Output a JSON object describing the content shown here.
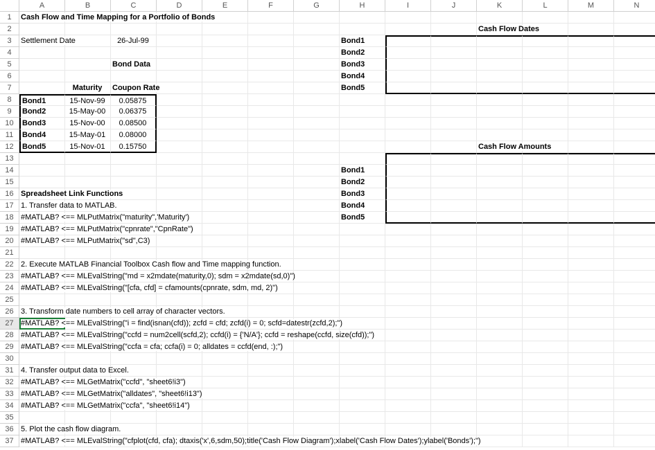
{
  "columns": [
    "A",
    "B",
    "C",
    "D",
    "E",
    "F",
    "G",
    "H",
    "I",
    "J",
    "K",
    "L",
    "M",
    "N"
  ],
  "row_count": 37,
  "selected_row": 27,
  "title": "Cash Flow and Time Mapping for a Portfolio of Bonds",
  "settlement_label": "Settlement Date",
  "settlement_date": "26-Jul-99",
  "bond_data_heading": "Bond Data",
  "maturity_header": "Maturity",
  "coupon_header": "Coupon Rate",
  "bonds": [
    {
      "name": "Bond1",
      "maturity": "15-Nov-99",
      "coupon": "0.05875"
    },
    {
      "name": "Bond2",
      "maturity": "15-May-00",
      "coupon": "0.06375"
    },
    {
      "name": "Bond3",
      "maturity": "15-Nov-00",
      "coupon": "0.08500"
    },
    {
      "name": "Bond4",
      "maturity": "15-May-01",
      "coupon": "0.08000"
    },
    {
      "name": "Bond5",
      "maturity": "15-Nov-01",
      "coupon": "0.15750"
    }
  ],
  "cash_flow_dates_heading": "Cash Flow Dates",
  "cash_flow_amounts_heading": "Cash Flow Amounts",
  "bond_labels_right": [
    "Bond1",
    "Bond2",
    "Bond3",
    "Bond4",
    "Bond5"
  ],
  "functions_heading": "Spreadsheet Link Functions",
  "step1": "1. Transfer data to MATLAB.",
  "line18": "#MATLAB? <== MLPutMatrix(\"maturity\",'Maturity')",
  "line19": "#MATLAB? <== MLPutMatrix(\"cpnrate\",\"CpnRate\")",
  "line20": "#MATLAB? <== MLPutMatrix(\"sd\",C3)",
  "step2": "2.  Execute MATLAB Financial Toolbox Cash flow and Time mapping function.",
  "line23": "#MATLAB? <== MLEvalString(\"md = x2mdate(maturity,0); sdm = x2mdate(sd,0)\")",
  "line24": "#MATLAB? <== MLEvalString(\"[cfa, cfd] = cfamounts(cpnrate, sdm, md, 2)\")",
  "step3": "3. Transform date numbers to cell array of character vectors.",
  "line27": "#MATLAB? <== MLEvalString(\"i = find(isnan(cfd)); zcfd = cfd; zcfd(i) = 0; scfd=datestr(zcfd,2);\")",
  "line28": "#MATLAB? <== MLEvalString(\"ccfd = num2cell(scfd,2); ccfd(i) = {'N/A'}; ccfd = reshape(ccfd, size(cfd));\")",
  "line29": "#MATLAB? <== MLEvalString(\"ccfa = cfa; ccfa(i) = 0; alldates = ccfd(end, :);\")",
  "step4": "4.  Transfer output data to Excel.",
  "line32": "#MATLAB? <== MLGetMatrix(\"ccfd\", \"sheet6!i3\")",
  "line33": "#MATLAB? <== MLGetMatrix(\"alldates\", \"sheet6!i13\")",
  "line34": "#MATLAB? <== MLGetMatrix(\"ccfa\", \"sheet6!i14\")",
  "step5": "5. Plot the cash flow diagram.",
  "line37": "#MATLAB? <== MLEvalString(\"cfplot(cfd, cfa); dtaxis('x',6,sdm,50);title('Cash Flow Diagram');xlabel('Cash Flow Dates');ylabel('Bonds');\")"
}
